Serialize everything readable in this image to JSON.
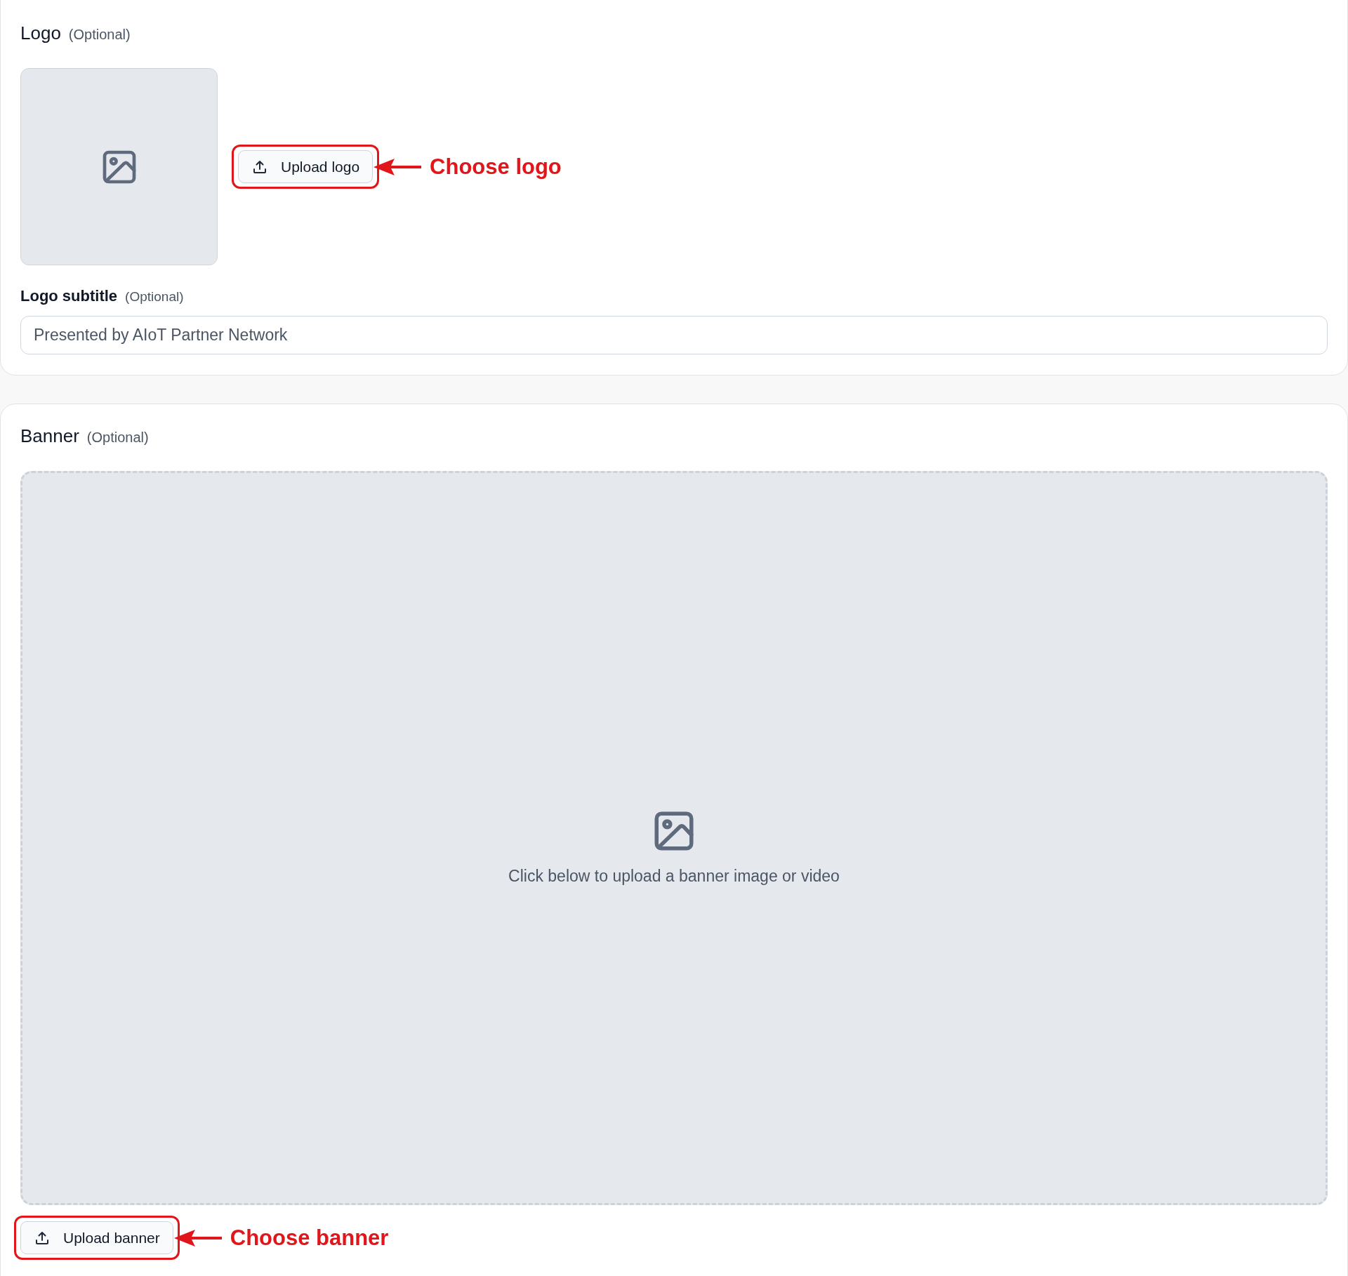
{
  "logo_section": {
    "title": "Logo",
    "optional_note": "(Optional)",
    "upload_button": "Upload logo",
    "callout": "Choose logo",
    "subtitle_field": {
      "label": "Logo subtitle",
      "optional_note": "(Optional)",
      "value": "Presented by AIoT Partner Network"
    }
  },
  "banner_section": {
    "title": "Banner",
    "optional_note": "(Optional)",
    "hint": "Click below to upload a banner image or video",
    "upload_button": "Upload banner",
    "callout": "Choose banner"
  }
}
